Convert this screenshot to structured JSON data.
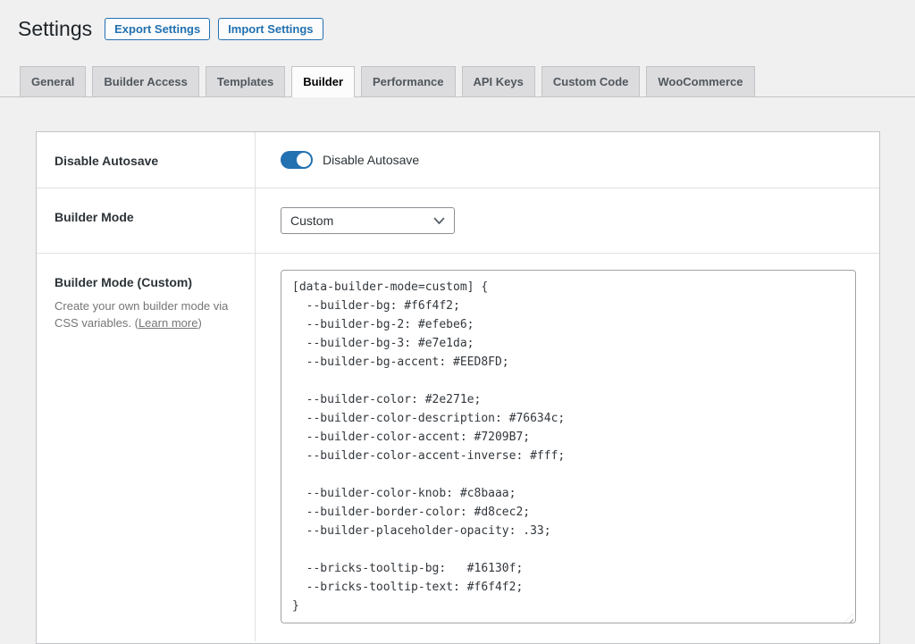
{
  "page": {
    "title": "Settings",
    "export_button": "Export Settings",
    "import_button": "Import Settings"
  },
  "tabs": [
    {
      "label": "General",
      "active": false
    },
    {
      "label": "Builder Access",
      "active": false
    },
    {
      "label": "Templates",
      "active": false
    },
    {
      "label": "Builder",
      "active": true
    },
    {
      "label": "Performance",
      "active": false
    },
    {
      "label": "API Keys",
      "active": false
    },
    {
      "label": "Custom Code",
      "active": false
    },
    {
      "label": "WooCommerce",
      "active": false
    }
  ],
  "rows": {
    "autosave": {
      "label": "Disable Autosave",
      "toggle_label": "Disable Autosave",
      "state": "on"
    },
    "builder_mode": {
      "label": "Builder Mode",
      "value": "Custom"
    },
    "builder_mode_custom": {
      "label": "Builder Mode (Custom)",
      "description": "Create your own builder mode via CSS variables.",
      "link_open": "(",
      "link_label": "Learn more",
      "link_close": ")",
      "code": "[data-builder-mode=custom] {\n  --builder-bg: #f6f4f2;\n  --builder-bg-2: #efebe6;\n  --builder-bg-3: #e7e1da;\n  --builder-bg-accent: #EED8FD;\n\n  --builder-color: #2e271e;\n  --builder-color-description: #76634c;\n  --builder-color-accent: #7209B7;\n  --builder-color-accent-inverse: #fff;\n\n  --builder-color-knob: #c8baaa;\n  --builder-border-color: #d8cec2;\n  --builder-placeholder-opacity: .33;\n\n  --bricks-tooltip-bg:   #16130f;\n  --bricks-tooltip-text: #f6f4f2;\n}"
    }
  },
  "colors": {
    "accent": "#2271b1",
    "page-bg": "#f0f0f1",
    "card-bg": "#ffffff",
    "tab-bg": "#dcdcde",
    "border": "#c3c4c7",
    "divider": "#e0e0e0",
    "text": "#1d2327",
    "muted": "#757575"
  }
}
